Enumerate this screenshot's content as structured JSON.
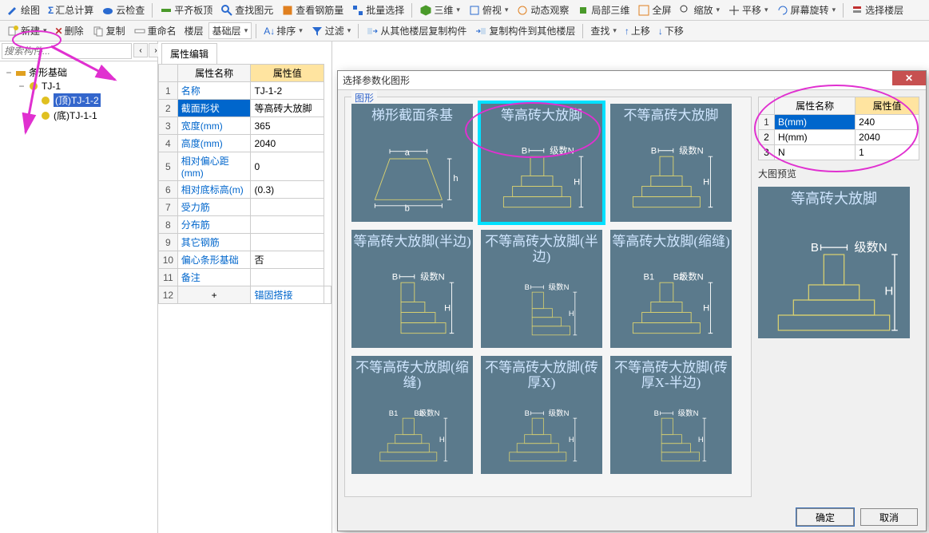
{
  "toolbar1": {
    "draw": "绘图",
    "sum": "汇总计算",
    "cloud": "云检查",
    "flatten": "平齐板顶",
    "find": "查找图元",
    "rebar": "查看钢筋量",
    "batch": "批量选择",
    "view3d": "三维",
    "bird": "俯视",
    "dyn": "动态观察",
    "local3d": "局部三维",
    "full": "全屏",
    "zoom": "缩放",
    "pan": "平移",
    "rotate": "屏幕旋转",
    "selfloor": "选择楼层"
  },
  "toolbar2": {
    "new": "新建",
    "del": "删除",
    "copy": "复制",
    "rename": "重命名",
    "floor_lbl": "楼层",
    "floor_val": "基础层",
    "sort": "排序",
    "filter": "过滤",
    "copyfrom": "从其他楼层复制构件",
    "copyto": "复制构件到其他楼层",
    "find": "查找",
    "up": "上移",
    "down": "下移"
  },
  "search_placeholder": "搜索构件...",
  "tree": {
    "root": "条形基础",
    "n1": "TJ-1",
    "n2": "(顶)TJ-1-2",
    "n3": "(底)TJ-1-1"
  },
  "prop_tab": "属性编辑",
  "prop_head_name": "属性名称",
  "prop_head_val": "属性值",
  "props": [
    {
      "n": "名称",
      "v": "TJ-1-2"
    },
    {
      "n": "截面形状",
      "v": "等高砖大放脚"
    },
    {
      "n": "宽度(mm)",
      "v": "365"
    },
    {
      "n": "高度(mm)",
      "v": "2040"
    },
    {
      "n": "相对偏心距(mm)",
      "v": "0"
    },
    {
      "n": "相对底标高(m)",
      "v": "(0.3)"
    },
    {
      "n": "受力筋",
      "v": ""
    },
    {
      "n": "分布筋",
      "v": ""
    },
    {
      "n": "其它钢筋",
      "v": ""
    },
    {
      "n": "偏心条形基础",
      "v": "否"
    },
    {
      "n": "备注",
      "v": ""
    },
    {
      "n": "锚固搭接",
      "v": ""
    }
  ],
  "dialog": {
    "title": "选择参数化图形",
    "shapes_legend": "图形",
    "preview_label": "大图预览",
    "ok": "确定",
    "cancel": "取消",
    "shapes": [
      "梯形截面条基",
      "等高砖大放脚",
      "不等高砖大放脚",
      "等高砖大放脚(半边)",
      "不等高砖大放脚(半边)",
      "等高砖大放脚(缩缝)",
      "不等高砖大放脚(缩缝)",
      "不等高砖大放脚(砖厚X)",
      "不等高砖大放脚(砖厚X-半边)"
    ],
    "param_head_name": "属性名称",
    "param_head_val": "属性值",
    "params": [
      {
        "n": "B(mm)",
        "v": "240"
      },
      {
        "n": "H(mm)",
        "v": "2040"
      },
      {
        "n": "N",
        "v": "1"
      }
    ],
    "preview_title": "等高砖大放脚",
    "label_B": "B",
    "label_H": "H",
    "label_N": "级数N",
    "label_a": "a",
    "label_b": "b",
    "label_h": "h",
    "label_B1": "B1",
    "label_B2": "B2"
  }
}
